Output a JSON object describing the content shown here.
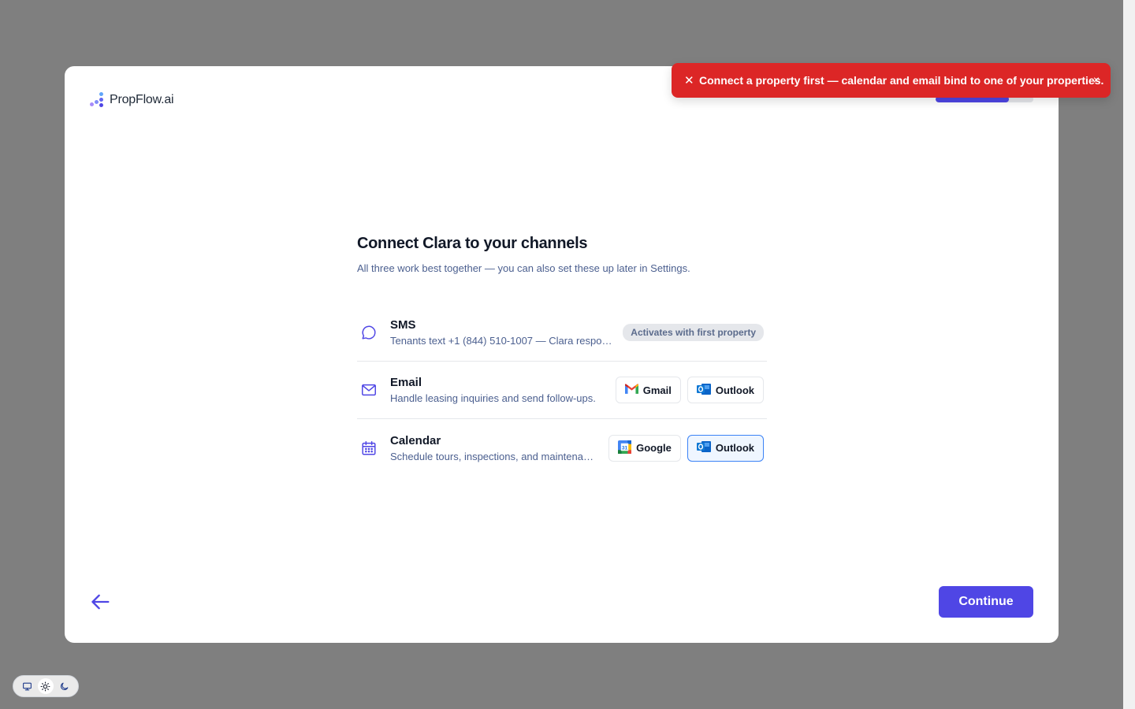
{
  "brand": {
    "name": "PropFlow.ai"
  },
  "onboarding": {
    "progress_fraction": 0.75
  },
  "page": {
    "title": "Connect Clara to your channels",
    "subtitle": "All three work best together — you can also set these up later in Settings."
  },
  "channels": [
    {
      "name": "SMS",
      "icon": "chat-bubble-icon",
      "description": "Tenants text +1 (844) 510-1007 — Clara respon...",
      "status": "Activates with first property"
    },
    {
      "name": "Email",
      "icon": "envelope-icon",
      "description": "Handle leasing inquiries and send follow-ups.",
      "providers": [
        "Gmail",
        "Outlook"
      ]
    },
    {
      "name": "Calendar",
      "icon": "calendar-icon",
      "description": "Schedule tours, inspections, and maintenan...",
      "providers": [
        "Google",
        "Outlook"
      ],
      "selected_provider": "Outlook"
    }
  ],
  "footer": {
    "continue_label": "Continue"
  },
  "toast": {
    "message": "Connect a property first — calendar and email bind to one of your properties.",
    "close_glyph": "×",
    "icon_glyph": "✕",
    "color": "#dc2626"
  },
  "colors": {
    "accent": "#4f46e5",
    "backdrop": "#7f7f7f"
  },
  "theme_switch": {
    "options": [
      "system",
      "light",
      "dark"
    ],
    "active": "light"
  }
}
